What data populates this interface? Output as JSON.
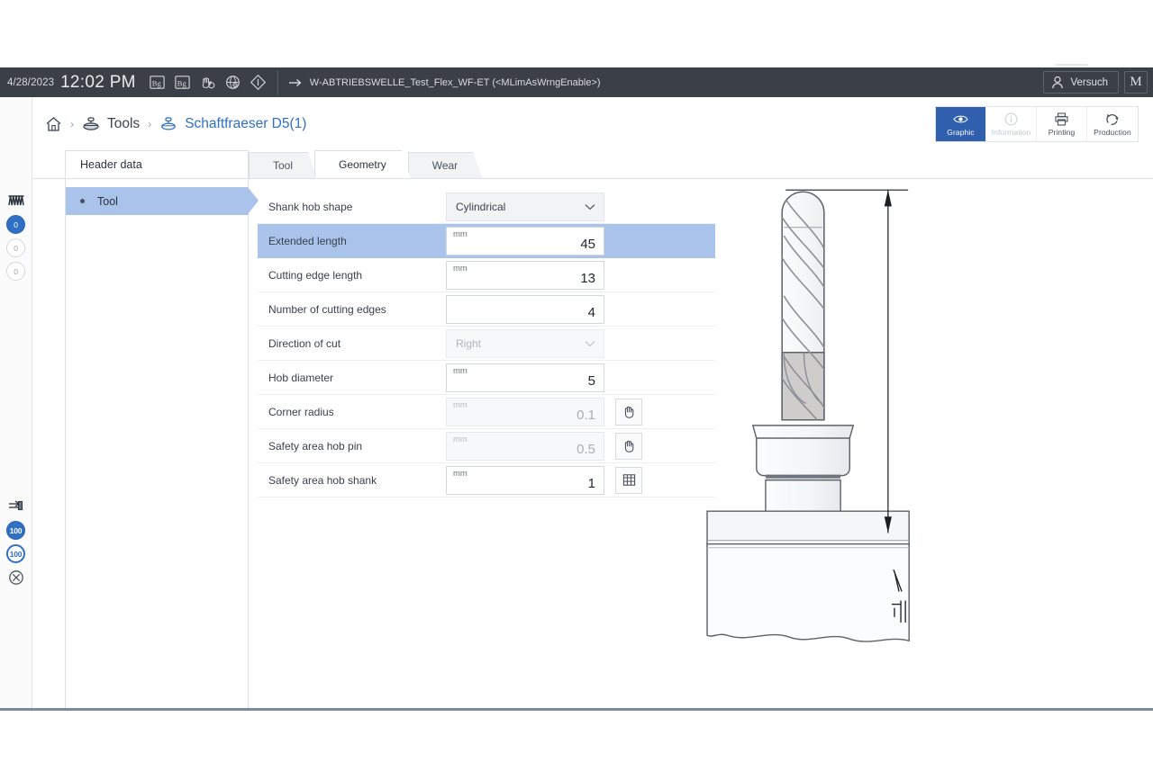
{
  "appbar": {
    "date": "4/28/2023",
    "time": "12:02 PM",
    "icons": [
      "bg-icon",
      "bg-icon",
      "hand-globe-icon",
      "globe-target-icon",
      "diamond-warning-icon"
    ],
    "path_arrow": "arrow-right-icon",
    "path_text": "W-ABTRIEBSWELLE_Test_Flex_WF-ET (<MLimAsWrngEnable>)",
    "user_label": "Versuch",
    "user_icon": "user-icon",
    "brand_label": "M"
  },
  "breadcrumb": {
    "items": [
      {
        "label": "",
        "icon": "home-icon"
      },
      {
        "label": "Tools",
        "icon": "tool-group-icon"
      },
      {
        "label": "Schaftfraeser D5(1)",
        "icon": "tool-icon"
      }
    ],
    "separator": "›"
  },
  "modebar": {
    "items": [
      {
        "label": "Graphic",
        "icon": "eye-icon",
        "state": "selected"
      },
      {
        "label": "Information",
        "icon": "info-icon",
        "state": "disabled"
      },
      {
        "label": "Printing",
        "icon": "printer-icon",
        "state": "normal"
      },
      {
        "label": "Production",
        "icon": "recycle-icon",
        "state": "normal"
      }
    ]
  },
  "header_tab": {
    "label": "Header data"
  },
  "tabs": [
    {
      "label": "Tool",
      "active": false
    },
    {
      "label": "Geometry",
      "active": true
    },
    {
      "label": "Wear",
      "active": false
    }
  ],
  "navpane": {
    "items": [
      {
        "label": "Tool",
        "selected": true
      }
    ]
  },
  "form": {
    "rows": [
      {
        "label": "Shank hob shape",
        "type": "select",
        "value": "Cylindrical",
        "unit": "",
        "disabled": false,
        "highlight": false,
        "button": ""
      },
      {
        "label": "Extended length",
        "type": "input",
        "value": "45",
        "unit": "mm",
        "readonly": false,
        "highlight": true,
        "button": ""
      },
      {
        "label": "Cutting edge length",
        "type": "input",
        "value": "13",
        "unit": "mm",
        "readonly": false,
        "highlight": false,
        "button": ""
      },
      {
        "label": "Number of cutting edges",
        "type": "input",
        "value": "4",
        "unit": "",
        "readonly": false,
        "highlight": false,
        "button": ""
      },
      {
        "label": "Direction of cut",
        "type": "select",
        "value": "Right",
        "unit": "",
        "disabled": true,
        "highlight": false,
        "button": ""
      },
      {
        "label": "Hob diameter",
        "type": "input",
        "value": "5",
        "unit": "mm",
        "readonly": false,
        "highlight": false,
        "button": ""
      },
      {
        "label": "Corner radius",
        "type": "input",
        "value": "0.1",
        "unit": "mm",
        "readonly": true,
        "highlight": false,
        "button": "hand-icon"
      },
      {
        "label": "Safety area hob pin",
        "type": "input",
        "value": "0.5",
        "unit": "mm",
        "readonly": true,
        "highlight": false,
        "button": "hand-icon"
      },
      {
        "label": "Safety area hob shank",
        "type": "input",
        "value": "1",
        "unit": "mm",
        "readonly": false,
        "highlight": false,
        "button": "table-icon"
      }
    ]
  },
  "graphic": {
    "name": "end-mill-tool-drawing",
    "dimension_arrow": "extended-length-dimension"
  },
  "colors": {
    "appbar_bg": "#3b4046",
    "accent_blue": "#2f6fc4",
    "mode_selected": "#2f5fad",
    "row_highlight": "#a9c3ea",
    "tab_inactive": "#f2f3f5",
    "border": "#dcdfe3"
  }
}
